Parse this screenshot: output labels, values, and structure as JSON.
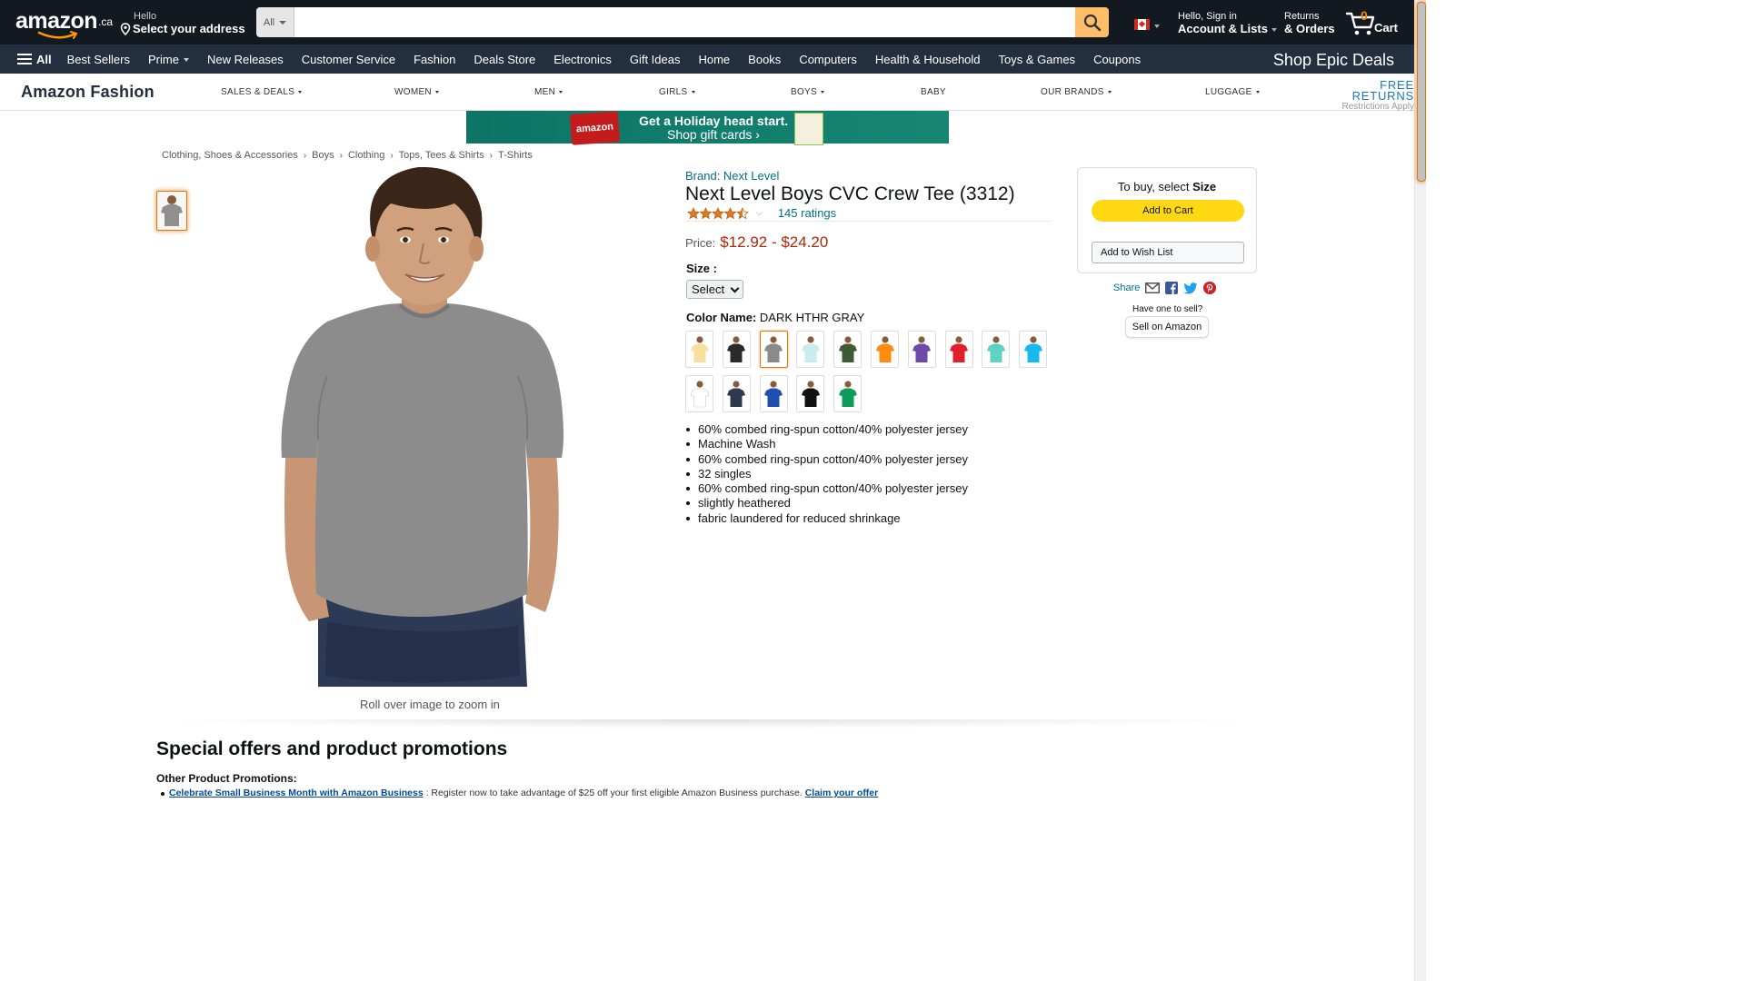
{
  "header": {
    "logo_text": "amazon",
    "logo_suffix": ".ca",
    "location_line1": "Hello",
    "location_line2": "Select your address",
    "search_category": "All",
    "search_placeholder": "",
    "account_line1": "Hello, Sign in",
    "account_line2": "Account & Lists",
    "returns_line1": "Returns",
    "returns_line2": "& Orders",
    "cart_count": "0",
    "cart_label": "Cart"
  },
  "nav": {
    "all_label": "All",
    "links": [
      "Best Sellers",
      "Prime",
      "New Releases",
      "Customer Service",
      "Fashion",
      "Deals Store",
      "Electronics",
      "Gift Ideas",
      "Home",
      "Books",
      "Computers",
      "Health & Household",
      "Toys & Games",
      "Coupons"
    ],
    "promo": "Shop Epic Deals"
  },
  "fashion_nav": {
    "brand": "Amazon Fashion",
    "items": [
      "SALES & DEALS",
      "WOMEN",
      "MEN",
      "GIRLS",
      "BOYS",
      "BABY",
      "OUR BRANDS",
      "LUGGAGE"
    ],
    "free_returns": "FREE RETURNS",
    "restrictions": "Restrictions Apply"
  },
  "banner": {
    "card_text": "amazon",
    "line1": "Get a Holiday head start.",
    "line2": "Shop gift cards ›"
  },
  "breadcrumb": [
    "Clothing, Shoes & Accessories",
    "Boys",
    "Clothing",
    "Tops, Tees & Shirts",
    "T-Shirts"
  ],
  "product": {
    "brand_link": "Brand: Next Level",
    "title": "Next Level Boys CVC Crew Tee (3312)",
    "rating": 4.5,
    "ratings_count": "145 ratings",
    "price_label": "Price:",
    "price": "$12.92 - $24.20",
    "size_label": "Size :",
    "size_value": "Select",
    "color_label": "Color Name:",
    "color_value": "DARK HTHR GRAY",
    "zoom_hint": "Roll over image to zoom in",
    "swatches": [
      {
        "color": "#f7df9e",
        "selected": false
      },
      {
        "color": "#2b2b2b",
        "selected": false
      },
      {
        "color": "#8a8a8a",
        "selected": true
      },
      {
        "color": "#c9ecf0",
        "selected": false
      },
      {
        "color": "#3f5b34",
        "selected": false
      },
      {
        "color": "#ff8c10",
        "selected": false
      },
      {
        "color": "#6e4aa8",
        "selected": false
      },
      {
        "color": "#e01f2b",
        "selected": false
      },
      {
        "color": "#5fd2c4",
        "selected": false
      },
      {
        "color": "#17b9ec",
        "selected": false
      },
      {
        "color": "#ffffff",
        "selected": false
      },
      {
        "color": "#2f3a4e",
        "selected": false
      },
      {
        "color": "#1f4fb0",
        "selected": false
      },
      {
        "color": "#111111",
        "selected": false
      },
      {
        "color": "#0e9a5a",
        "selected": false
      }
    ],
    "bullets": [
      "60% combed ring-spun cotton/40% polyester jersey",
      "Machine Wash",
      "60% combed ring-spun cotton/40% polyester jersey",
      "32 singles",
      "60% combed ring-spun cotton/40% polyester jersey",
      "slightly heathered",
      "fabric laundered for reduced shrinkage"
    ]
  },
  "buybox": {
    "prompt_prefix": "To buy, select ",
    "prompt_bold": "Size",
    "add_to_cart": "Add to Cart",
    "add_to_wishlist": "Add to Wish List",
    "share": "Share",
    "have_one": "Have one to sell?",
    "sell": "Sell on Amazon"
  },
  "promotions": {
    "heading": "Special offers and product promotions",
    "sub": "Other Product Promotions:",
    "link": "Celebrate Small Business Month with Amazon Business",
    "text": " : Register now to take advantage of $25 off your first eligible Amazon Business purchase. ",
    "claim": "Claim your offer"
  },
  "colors": {
    "nav_dark": "#131921",
    "nav_secondary": "#232f3e",
    "search_button": "#febd69",
    "add_to_cart": "#ffd814",
    "price": "#b12704",
    "link": "#007185"
  }
}
